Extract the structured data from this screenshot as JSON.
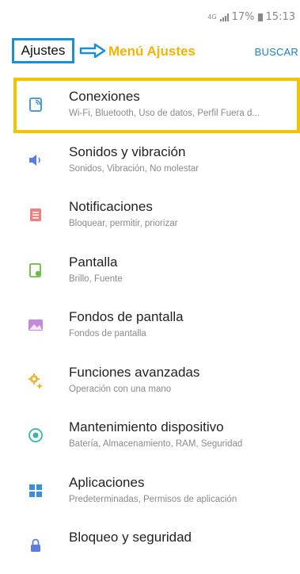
{
  "status": {
    "signal_label": "4G",
    "battery": "17%",
    "time": "15:13"
  },
  "header": {
    "title": "Ajustes",
    "annotation": "Menú Ajustes",
    "search": "BUSCAR"
  },
  "items": [
    {
      "title": "Conexiones",
      "subtitle": "Wi-Fi, Bluetooth, Uso de datos, Perfil Fuera d...",
      "icon": "connections-icon"
    },
    {
      "title": "Sonidos y vibración",
      "subtitle": "Sonidos, Vibración, No molestar",
      "icon": "sound-icon"
    },
    {
      "title": "Notificaciones",
      "subtitle": "Bloquear, permitir, priorizar",
      "icon": "notifications-icon"
    },
    {
      "title": "Pantalla",
      "subtitle": "Brillo, Fuente",
      "icon": "display-icon"
    },
    {
      "title": "Fondos de pantalla",
      "subtitle": "Fondos de pantalla",
      "icon": "wallpaper-icon"
    },
    {
      "title": "Funciones avanzadas",
      "subtitle": "Operación con una mano",
      "icon": "advanced-features-icon"
    },
    {
      "title": "Mantenimiento dispositivo",
      "subtitle": "Batería, Almacenamiento, RAM, Seguridad",
      "icon": "device-maintenance-icon"
    },
    {
      "title": "Aplicaciones",
      "subtitle": "Predeterminadas, Permisos de aplicación",
      "icon": "apps-icon"
    },
    {
      "title": "Bloqueo y seguridad",
      "subtitle": "",
      "icon": "lock-icon"
    }
  ],
  "colors": {
    "highlight": "#f4c300",
    "title_box": "#1a8fd6",
    "annotation": "#f4b400",
    "search": "#1a7fc4"
  }
}
